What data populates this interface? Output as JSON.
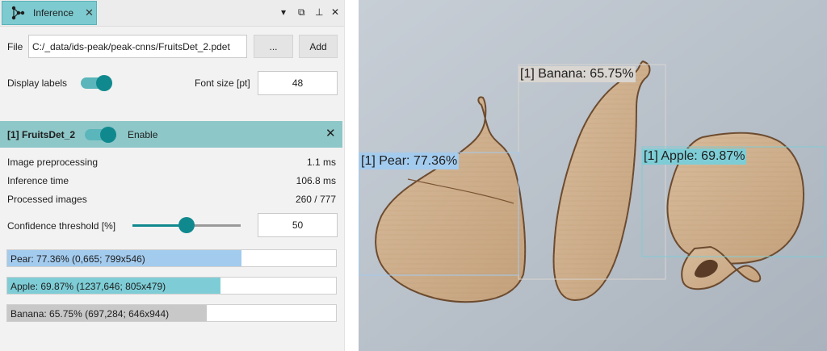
{
  "window": {
    "tab_title": "Inference",
    "tab_icon": "network-icon",
    "controls": [
      "▾",
      "⧉",
      "⊥",
      "✕"
    ]
  },
  "file_row": {
    "label": "File",
    "path": "C:/_data/ids-peak/peak-cnns/FruitsDet_2.pdet",
    "browse_label": "...",
    "add_label": "Add"
  },
  "display_row": {
    "label": "Display labels",
    "toggle_on": true,
    "font_size_label": "Font size [pt]",
    "font_size_value": "48"
  },
  "network": {
    "title": "[1] FruitsDet_2",
    "enable_label": "Enable",
    "enabled": true,
    "stats": [
      {
        "label": "Image preprocessing",
        "value": "1.1 ms"
      },
      {
        "label": "Inference time",
        "value": "106.8 ms"
      },
      {
        "label": "Processed images",
        "value": "260 / 777"
      }
    ],
    "confidence": {
      "label": "Confidence threshold [%]",
      "value": "50",
      "slider_fraction": 0.5
    },
    "results": [
      {
        "text": "Pear: 77.36% (0,665; 799x546)",
        "fraction": 0.7136,
        "color": "#a3cbee"
      },
      {
        "text": "Apple: 69.87% (1237,646; 805x479)",
        "fraction": 0.6487,
        "color": "#7ecdd6"
      },
      {
        "text": "Banana: 65.75% (697,284; 646x944)",
        "fraction": 0.6075,
        "color": "#c8c8c8"
      }
    ]
  },
  "image": {
    "labels": {
      "banana": "[1] Banana: 65.75%",
      "pear": "[1] Pear: 77.36%",
      "apple": "[1] Apple: 69.87%"
    },
    "colors": {
      "background": "#b9c1c9",
      "wood": "#cfb090",
      "wood_dark": "#6b4a2e",
      "pear_box": "#a3cbee",
      "apple_box": "#7ecdd6",
      "banana_box": "#d9d5d0"
    }
  }
}
